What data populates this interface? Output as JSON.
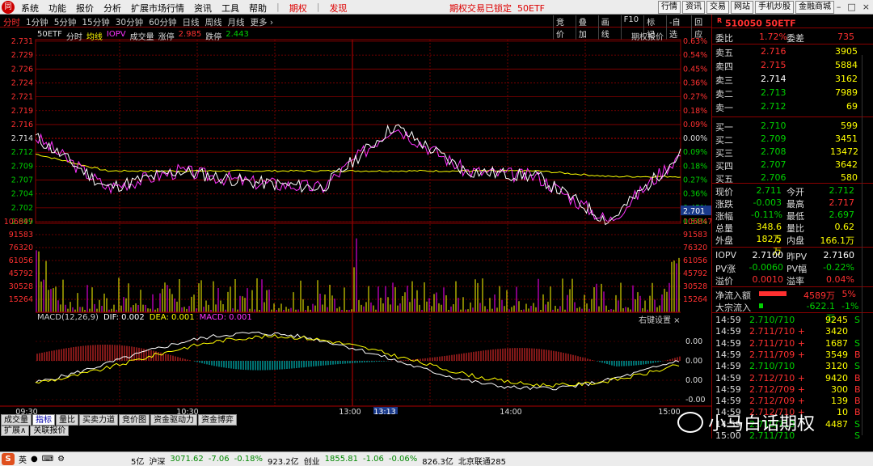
{
  "menu": {
    "items": [
      "系统",
      "功能",
      "报价",
      "分析",
      "扩展市场行情",
      "资讯",
      "工具",
      "帮助"
    ],
    "option": "期权",
    "discover": "发现",
    "lock_notice": "期权交易已锁定",
    "lock_code": "50ETF",
    "right": [
      "行情",
      "资讯",
      "交易",
      "网站",
      "手机炒股",
      "金融商城"
    ]
  },
  "tabs": [
    "分时",
    "1分钟",
    "5分钟",
    "15分钟",
    "30分钟",
    "60分钟",
    "日线",
    "周线",
    "月线",
    "更多 ›"
  ],
  "tools": [
    "竞价",
    "叠加",
    "画线",
    "F10",
    "标记",
    "-自选",
    "回应"
  ],
  "chart": {
    "name": "50ETF",
    "labels": [
      "分时",
      "均线",
      "IOPV",
      "成交量",
      "涨停",
      "2.985",
      "跌停",
      "2.443"
    ],
    "option_price": "期权报价",
    "price_ticks": [
      "2.731",
      "2.729",
      "2.726",
      "2.724",
      "2.721",
      "2.719",
      "2.716",
      "2.714",
      "2.712",
      "2.709",
      "2.707",
      "2.704",
      "2.702",
      "2.699"
    ],
    "pct_ticks": [
      "0.63%",
      "0.54%",
      "0.45%",
      "0.36%",
      "0.27%",
      "0.18%",
      "0.09%",
      "0.00%",
      "0.09%",
      "0.18%",
      "0.27%",
      "0.36%",
      "0.45%",
      "0.54%"
    ],
    "cur_price": "2.701",
    "vol_ticks": [
      "106847",
      "91583",
      "76320",
      "61056",
      "45792",
      "30528",
      "15264"
    ],
    "macd_labels": [
      "MACD(12,26,9)",
      "DIF: 0.002",
      "DEA: 0.001",
      "MACD: 0.001"
    ],
    "macd_ticks": [
      "0.00",
      "0.00",
      "0.00",
      "-0.00"
    ],
    "right_settings": "右键设置  ×",
    "time_ticks": [
      "09:30",
      "10:30",
      "13:00",
      "13:13",
      "14:00",
      "15:00"
    ],
    "colors": {
      "price": "#ffffff",
      "avg": "#ffff00",
      "iopv": "#ff33ff",
      "grid": "#8b0000",
      "up": "#ff3030",
      "down": "#00e0e0"
    }
  },
  "chart_data": {
    "type": "line",
    "series": [
      {
        "name": "分时",
        "x": [
          "09:30",
          "10:00",
          "10:30",
          "11:00",
          "11:30",
          "13:00",
          "13:30",
          "14:00",
          "14:30",
          "15:00"
        ],
        "values": [
          2.714,
          2.705,
          2.708,
          2.706,
          2.705,
          2.716,
          2.708,
          2.707,
          2.699,
          2.711
        ]
      },
      {
        "name": "均线",
        "x": [
          "09:30",
          "10:00",
          "10:30",
          "11:00",
          "11:30",
          "13:00",
          "13:30",
          "14:00",
          "14:30",
          "15:00"
        ],
        "values": [
          2.711,
          2.708,
          2.708,
          2.708,
          2.708,
          2.708,
          2.708,
          2.708,
          2.707,
          2.707
        ]
      }
    ],
    "macd": {
      "DIF": 0.002,
      "DEA": 0.001,
      "MACD": 0.001
    },
    "ylim": [
      2.699,
      2.731
    ]
  },
  "quote": {
    "code": "510050",
    "name": "50ETF",
    "flag": "R",
    "weibi": "委比",
    "weibi_v": "1.72%",
    "weicha": "委差",
    "weicha_v": "735",
    "sells": [
      [
        "卖五",
        "2.716",
        "3905"
      ],
      [
        "卖四",
        "2.715",
        "5884"
      ],
      [
        "卖三",
        "2.714",
        "3162"
      ],
      [
        "卖二",
        "2.713",
        "7989"
      ],
      [
        "卖一",
        "2.712",
        "69"
      ]
    ],
    "buys": [
      [
        "买一",
        "2.710",
        "599"
      ],
      [
        "买二",
        "2.709",
        "3451"
      ],
      [
        "买三",
        "2.708",
        "13472"
      ],
      [
        "买四",
        "2.707",
        "3642"
      ],
      [
        "买五",
        "2.706",
        "580"
      ]
    ],
    "stats": [
      [
        "现价",
        "2.711",
        "今开",
        "2.712"
      ],
      [
        "涨跌",
        "-0.003",
        "最高",
        "2.717"
      ],
      [
        "涨幅",
        "-0.11%",
        "最低",
        "2.697"
      ],
      [
        "总量",
        "348.6万",
        "量比",
        "0.62"
      ],
      [
        "外盘",
        "182.5万",
        "内盘",
        "166.1万"
      ]
    ],
    "iopv": [
      [
        "IOPV",
        "2.7100",
        "昨PV",
        "2.7160"
      ],
      [
        "PV涨",
        "-0.0060",
        "PV幅",
        "-0.22%"
      ],
      [
        "溢价",
        "0.0010",
        "溢率",
        "0.04%"
      ]
    ],
    "flow": [
      [
        "净流入额",
        "4589万",
        "5%"
      ],
      [
        "大宗流入",
        "-622.1万",
        "-1%"
      ]
    ],
    "ticks": [
      [
        "14:59",
        "2.710/710",
        "9245",
        "S"
      ],
      [
        "14:59",
        "2.711/710 +",
        "3420",
        ""
      ],
      [
        "14:59",
        "2.711/710 +",
        "1687",
        "S"
      ],
      [
        "14:59",
        "2.711/709 +",
        "3549",
        "B"
      ],
      [
        "14:59",
        "2.710/710",
        "3120",
        "S"
      ],
      [
        "14:59",
        "2.712/710 +",
        "9420",
        "B"
      ],
      [
        "14:59",
        "2.712/709 +",
        "300",
        "B"
      ],
      [
        "14:59",
        "2.712/709 +",
        "139",
        "B"
      ],
      [
        "14:59",
        "2.712/710 +",
        "10",
        "B"
      ],
      [
        "14:59",
        "2.710/710",
        "4487",
        "S"
      ],
      [
        "15:00",
        "2.711/710",
        "",
        "S"
      ]
    ]
  },
  "bottom_tabs": [
    "成交量",
    "指标",
    "量比",
    "买卖力道",
    "竞价图",
    "资金驱动力",
    "资金博弈"
  ],
  "bottom_tabs2": [
    "扩展∧",
    "关联报价"
  ],
  "status": {
    "ime": "英",
    "mkt": [
      [
        "5亿",
        "#000"
      ],
      [
        "沪深",
        "#000"
      ],
      [
        "3071.62",
        "#008800"
      ],
      [
        "-7.06",
        "#008800"
      ],
      [
        "-0.18%",
        "#008800"
      ],
      [
        "923.2亿",
        "#000"
      ],
      [
        "创业",
        "#000"
      ],
      [
        "1855.81",
        "#008800"
      ],
      [
        "-1.06",
        "#008800"
      ],
      [
        "-0.06%",
        "#008800"
      ],
      [
        "826.3亿",
        "#000"
      ],
      [
        "北京联通285",
        "#000"
      ]
    ]
  },
  "watermark": "小马白话期权"
}
